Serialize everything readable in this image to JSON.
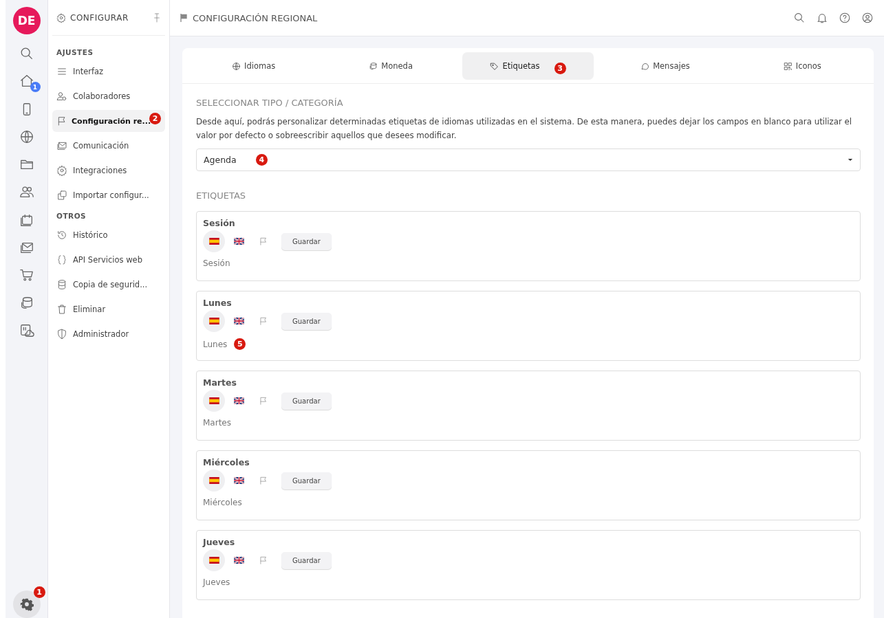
{
  "rail": {
    "avatar": "DE",
    "items": [
      {
        "kind": "search",
        "selected": false
      },
      {
        "kind": "home",
        "selected": false,
        "badge": "1"
      },
      {
        "kind": "phone",
        "selected": false
      },
      {
        "kind": "globe",
        "selected": false
      },
      {
        "kind": "folder",
        "selected": false
      },
      {
        "kind": "users",
        "selected": false
      },
      {
        "kind": "calendar",
        "selected": false
      },
      {
        "kind": "mail",
        "selected": false
      },
      {
        "kind": "cart",
        "selected": false
      },
      {
        "kind": "coins",
        "selected": false
      },
      {
        "kind": "cloud",
        "selected": false
      }
    ],
    "settings": {
      "badge": "1",
      "selected": true
    }
  },
  "sidebar": {
    "title": "CONFIGURAR",
    "sections": [
      {
        "heading": "AJUSTES",
        "items": [
          {
            "label": "Interfaz",
            "kind": "menu",
            "selected": false
          },
          {
            "label": "Colaboradores",
            "kind": "user",
            "selected": false
          },
          {
            "label": "Configuración re...",
            "kind": "flag",
            "selected": true,
            "badge": "2"
          },
          {
            "label": "Comunicación",
            "kind": "mail",
            "selected": false
          },
          {
            "label": "Integraciones",
            "kind": "gear",
            "selected": false
          },
          {
            "label": "Importar configur...",
            "kind": "copy",
            "selected": false
          }
        ]
      },
      {
        "heading": "OTROS",
        "items": [
          {
            "label": "Histórico",
            "kind": "history",
            "selected": false
          },
          {
            "label": "API Servicios web",
            "kind": "braces",
            "selected": false
          },
          {
            "label": "Copia de segurid...",
            "kind": "database",
            "selected": false
          },
          {
            "label": "Eliminar",
            "kind": "trash",
            "selected": false
          },
          {
            "label": "Administrador",
            "kind": "shield",
            "selected": false
          }
        ]
      }
    ]
  },
  "header": {
    "title": "CONFIGURACIÓN REGIONAL"
  },
  "tabs": [
    {
      "label": "Idiomas",
      "kind": "globe",
      "selected": false
    },
    {
      "label": "Moneda",
      "kind": "coins",
      "selected": false
    },
    {
      "label": "Etiquetas",
      "kind": "tag",
      "selected": true,
      "badge": "3"
    },
    {
      "label": "Mensajes",
      "kind": "chat",
      "selected": false
    },
    {
      "label": "Iconos",
      "kind": "grid",
      "selected": false
    }
  ],
  "select_section": {
    "title": "SELECCIONAR TIPO / CATEGORÍA",
    "description": "Desde aquí, podrás personalizar determinadas etiquetas de idiomas utilizadas en el sistema. De esta manera, puedes dejar los campos en blanco para utilizar el valor por defecto o sobreescribir aquellos que desees modificar.",
    "select": {
      "value": "Agenda",
      "badge": "4"
    }
  },
  "labels_section": {
    "title": "ETIQUETAS",
    "cards": [
      {
        "title": "Sesión",
        "languages": [
          {
            "kind": "es",
            "selected": true
          },
          {
            "kind": "uk",
            "selected": false
          },
          {
            "kind": "flag",
            "selected": false
          }
        ],
        "button": "Guardar",
        "value": "Sesión"
      },
      {
        "title": "Lunes",
        "languages": [
          {
            "kind": "es",
            "selected": true
          },
          {
            "kind": "uk",
            "selected": false
          },
          {
            "kind": "flag",
            "selected": false
          }
        ],
        "button": "Guardar",
        "value": "Lunes",
        "badge": "5"
      },
      {
        "title": "Martes",
        "languages": [
          {
            "kind": "es",
            "selected": true
          },
          {
            "kind": "uk",
            "selected": false
          },
          {
            "kind": "flag",
            "selected": false
          }
        ],
        "button": "Guardar",
        "value": "Martes"
      },
      {
        "title": "Miércoles",
        "languages": [
          {
            "kind": "es",
            "selected": true
          },
          {
            "kind": "uk",
            "selected": false
          },
          {
            "kind": "flag",
            "selected": false
          }
        ],
        "button": "Guardar",
        "value": "Miércoles"
      },
      {
        "title": "Jueves",
        "languages": [
          {
            "kind": "es",
            "selected": true
          },
          {
            "kind": "uk",
            "selected": false
          },
          {
            "kind": "flag",
            "selected": false
          }
        ],
        "button": "Guardar",
        "value": "Jueves"
      }
    ]
  }
}
